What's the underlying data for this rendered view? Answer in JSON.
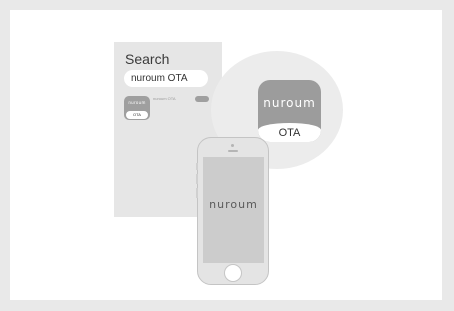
{
  "search": {
    "title": "Search",
    "query": "nuroum OTA"
  },
  "result": {
    "app_name": "nuroum OTA",
    "icon_brand": "nuroum",
    "icon_label": "OTA"
  },
  "zoom_icon": {
    "brand": "nuroum",
    "label": "OTA"
  },
  "phone": {
    "screen_brand": "nuroum"
  }
}
